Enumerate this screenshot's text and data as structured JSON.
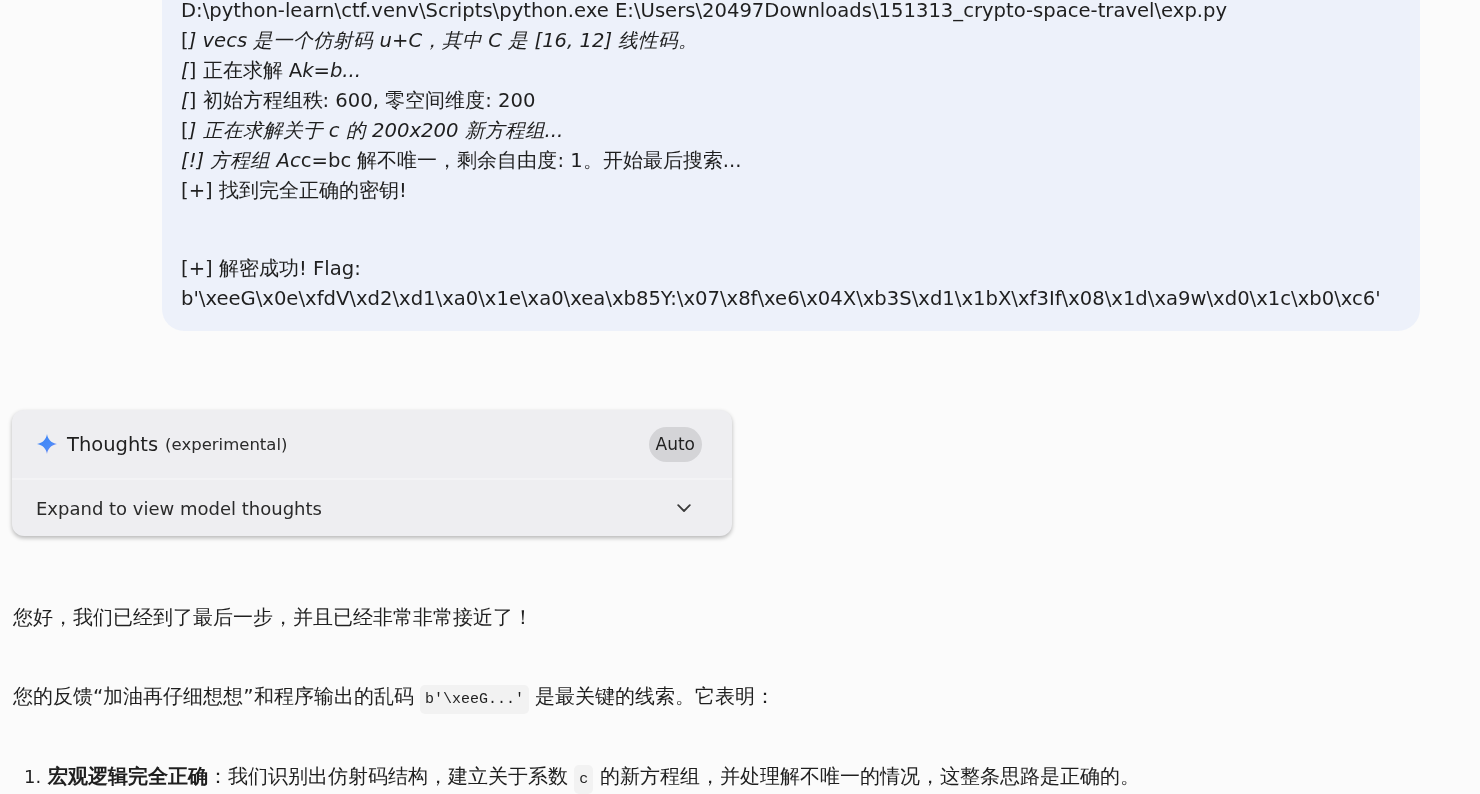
{
  "terminal_output": {
    "groups": [
      [
        [
          {
            "text": "D:\\python-learn\\ctf.venv\\Scripts\\python.exe E:\\Users\\20497Downloads\\151313_crypto-space-travel\\exp.py",
            "italic": false
          }
        ],
        [
          {
            "text": "[",
            "italic": false
          },
          {
            "text": "] vecs 是一个仿射码 u+C，其中 C 是 [16, 12] 线性码。",
            "italic": true
          }
        ],
        [
          {
            "text": "[",
            "italic": true
          },
          {
            "text": "] 正在求解 A",
            "italic": false
          },
          {
            "text": "k=b...",
            "italic": true
          }
        ],
        [
          {
            "text": "[",
            "italic": true
          },
          {
            "text": "] 初始方程组秩: 600, 零空间维度: 200",
            "italic": false
          }
        ],
        [
          {
            "text": "[",
            "italic": false
          },
          {
            "text": "] 正在求解关于 c 的 200x200 新方程组...",
            "italic": true
          }
        ],
        [
          {
            "text": "[!] 方程组 Ac",
            "italic": true
          },
          {
            "text": "c=bc 解不唯一，剩余自由度: 1。开始最后搜索...",
            "italic": false
          }
        ],
        [
          {
            "text": "[+] 找到完全正确的密钥!",
            "italic": false
          }
        ]
      ],
      [
        [
          {
            "text": "[+] 解密成功! Flag:",
            "italic": false
          }
        ],
        [
          {
            "text": "b'\\xeeG\\x0e\\xfdV\\xd2\\xd1\\xa0\\x1e\\xa0\\xea\\xb85Y:\\x07\\x8f\\xe6\\x04X\\xb3S\\xd1\\x1bX\\xf3If\\x08\\x1d\\xa9w\\xd0\\x1c\\xb0\\xc6'",
            "italic": false
          }
        ]
      ]
    ]
  },
  "thoughts_panel": {
    "title": "Thoughts",
    "subtitle": "(experimental)",
    "mode_button": "Auto",
    "expand_label": "Expand to view model thoughts",
    "expanded": false
  },
  "response": {
    "paragraphs": [
      {
        "segments": [
          {
            "kind": "text",
            "text": "您好，我们已经到了最后一步，并且已经非常非常接近了！"
          }
        ]
      },
      {
        "segments": [
          {
            "kind": "text",
            "text": "您的反馈“加油再仔细想想”和程序输出的乱码 "
          },
          {
            "kind": "code",
            "text": "b'\\xeeG...'"
          },
          {
            "kind": "text",
            "text": " 是最关键的线索。它表明："
          }
        ]
      }
    ],
    "list": [
      {
        "number": "1.",
        "segments": [
          {
            "kind": "text",
            "text": "**宏观逻辑完全正确**：我们识别出仿射码结构，建立关于系数 "
          },
          {
            "kind": "code",
            "text": "c"
          },
          {
            "kind": "text",
            "text": " 的新方程组，并处理解不唯一的情况，这整条思路是正确的。"
          }
        ]
      }
    ]
  }
}
